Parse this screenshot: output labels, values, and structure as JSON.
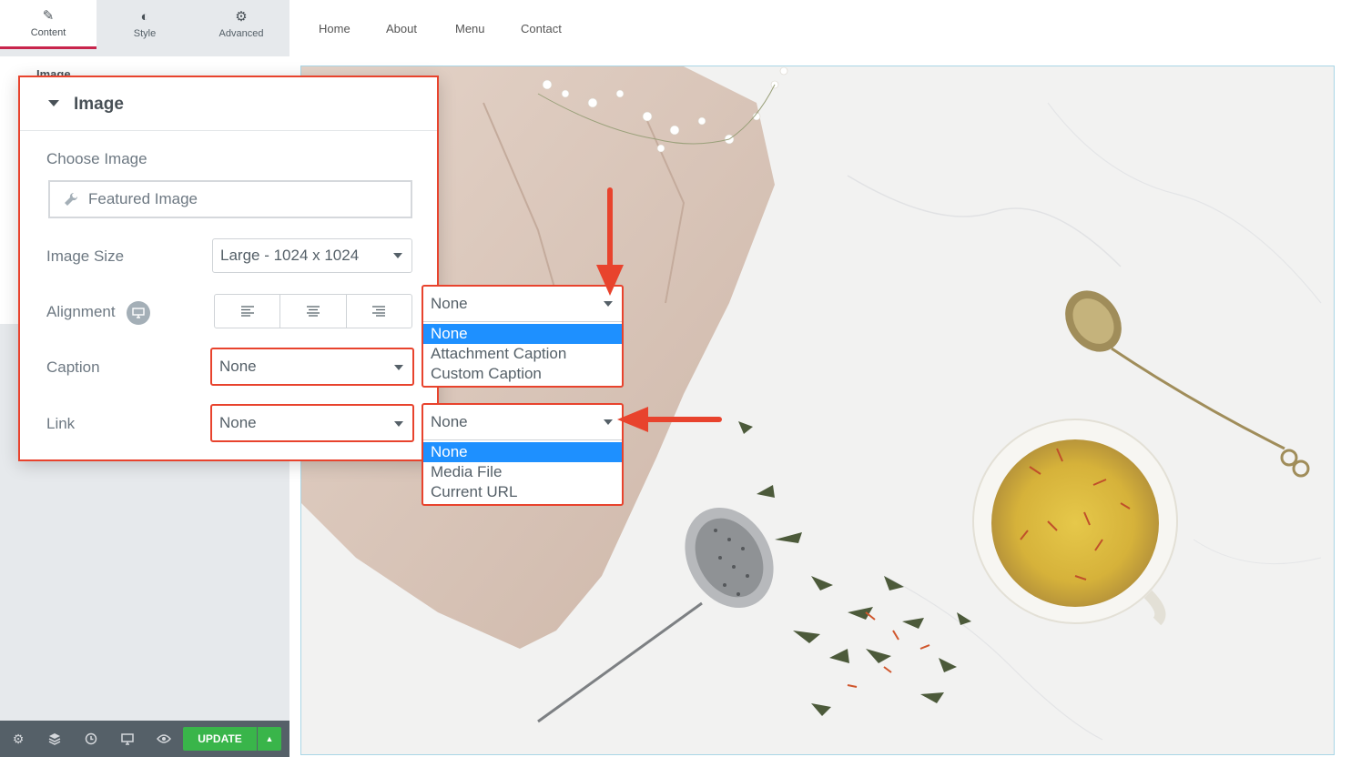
{
  "editor": {
    "tabs": [
      {
        "label": "Content",
        "icon": "pencil-icon",
        "active": true
      },
      {
        "label": "Style",
        "icon": "contrast-icon",
        "active": false
      },
      {
        "label": "Advanced",
        "icon": "gear-icon",
        "active": false
      }
    ],
    "background_section_title": "Image",
    "footer": {
      "update_label": "UPDATE",
      "icons": [
        "settings-icon",
        "layers-icon",
        "history-icon",
        "responsive-icon",
        "preview-icon"
      ],
      "update_color": "#39b54a"
    }
  },
  "nav": {
    "links": [
      "Home",
      "About",
      "Menu",
      "Contact"
    ]
  },
  "image_section": {
    "title": "Image",
    "choose_image_label": "Choose Image",
    "featured_image_label": "Featured Image",
    "image_size_label": "Image Size",
    "image_size_value": "Large - 1024 x 1024",
    "alignment_label": "Alignment",
    "caption_label": "Caption",
    "caption_value": "None",
    "link_label": "Link",
    "link_value": "None"
  },
  "caption_dropdown": {
    "selected": "None",
    "options": [
      "None",
      "Attachment Caption",
      "Custom Caption"
    ]
  },
  "link_dropdown": {
    "selected": "None",
    "options": [
      "None",
      "Media File",
      "Current URL"
    ]
  },
  "colors": {
    "highlight_red": "#e8432d",
    "option_selected": "#1e90ff",
    "tab_active_accent": "#c8254c"
  }
}
